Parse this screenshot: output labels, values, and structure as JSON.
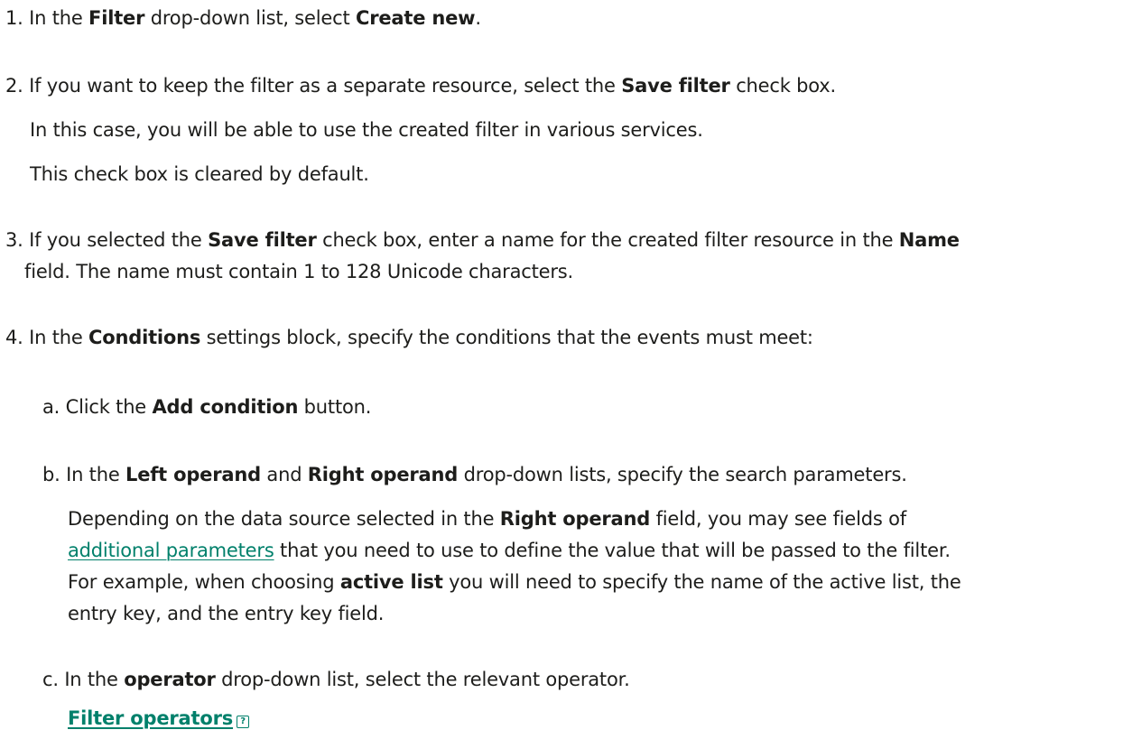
{
  "step1": {
    "num": "1.",
    "t1": "In the ",
    "b1": "Filter",
    "t2": " drop-down list, select ",
    "b2": "Create new",
    "t3": "."
  },
  "step2": {
    "num": "2.",
    "t1": "If you want to keep the filter as a separate resource, select the ",
    "b1": "Save filter",
    "t2": " check box.",
    "p1": "In this case, you will be able to use the created filter in various services.",
    "p2": "This check box is cleared by default."
  },
  "step3": {
    "num": "3.",
    "t1": "If you selected the ",
    "b1": "Save filter",
    "t2": " check box, enter a name for the created filter resource in the ",
    "b2": "Name",
    "line2": "field. The name must contain 1 to 128 Unicode characters."
  },
  "step4": {
    "num": "4.",
    "t1": "In the ",
    "b1": "Conditions",
    "t2": " settings block, specify the conditions that the events must meet:"
  },
  "sub_a": {
    "num": "a.",
    "t1": "Click the ",
    "b1": "Add condition",
    "t2": " button."
  },
  "sub_b": {
    "num": "b.",
    "t1": "In the ",
    "b1": "Left operand",
    "t2": " and ",
    "b2": "Right operand",
    "t3": " drop-down lists, specify the search parameters.",
    "p_t1": "Depending on the data source selected in the ",
    "p_b1": "Right operand",
    "p_t2": " field, you may see fields of",
    "link": "additional parameters",
    "p_t3": " that you need to use to define the value that will be passed to the filter.",
    "p_t4": "For example, when choosing ",
    "p_b2": "active list",
    "p_t5": " you will need to specify the name of the active list, the",
    "p_t6": "entry key, and the entry key field."
  },
  "sub_c": {
    "num": "c.",
    "t1": "In the ",
    "b1": "operator",
    "t2": " drop-down list, select the relevant operator.",
    "link": "Filter operators",
    "icon": "?"
  },
  "colors": {
    "text": "#1d1d1b",
    "link": "#00806b"
  }
}
